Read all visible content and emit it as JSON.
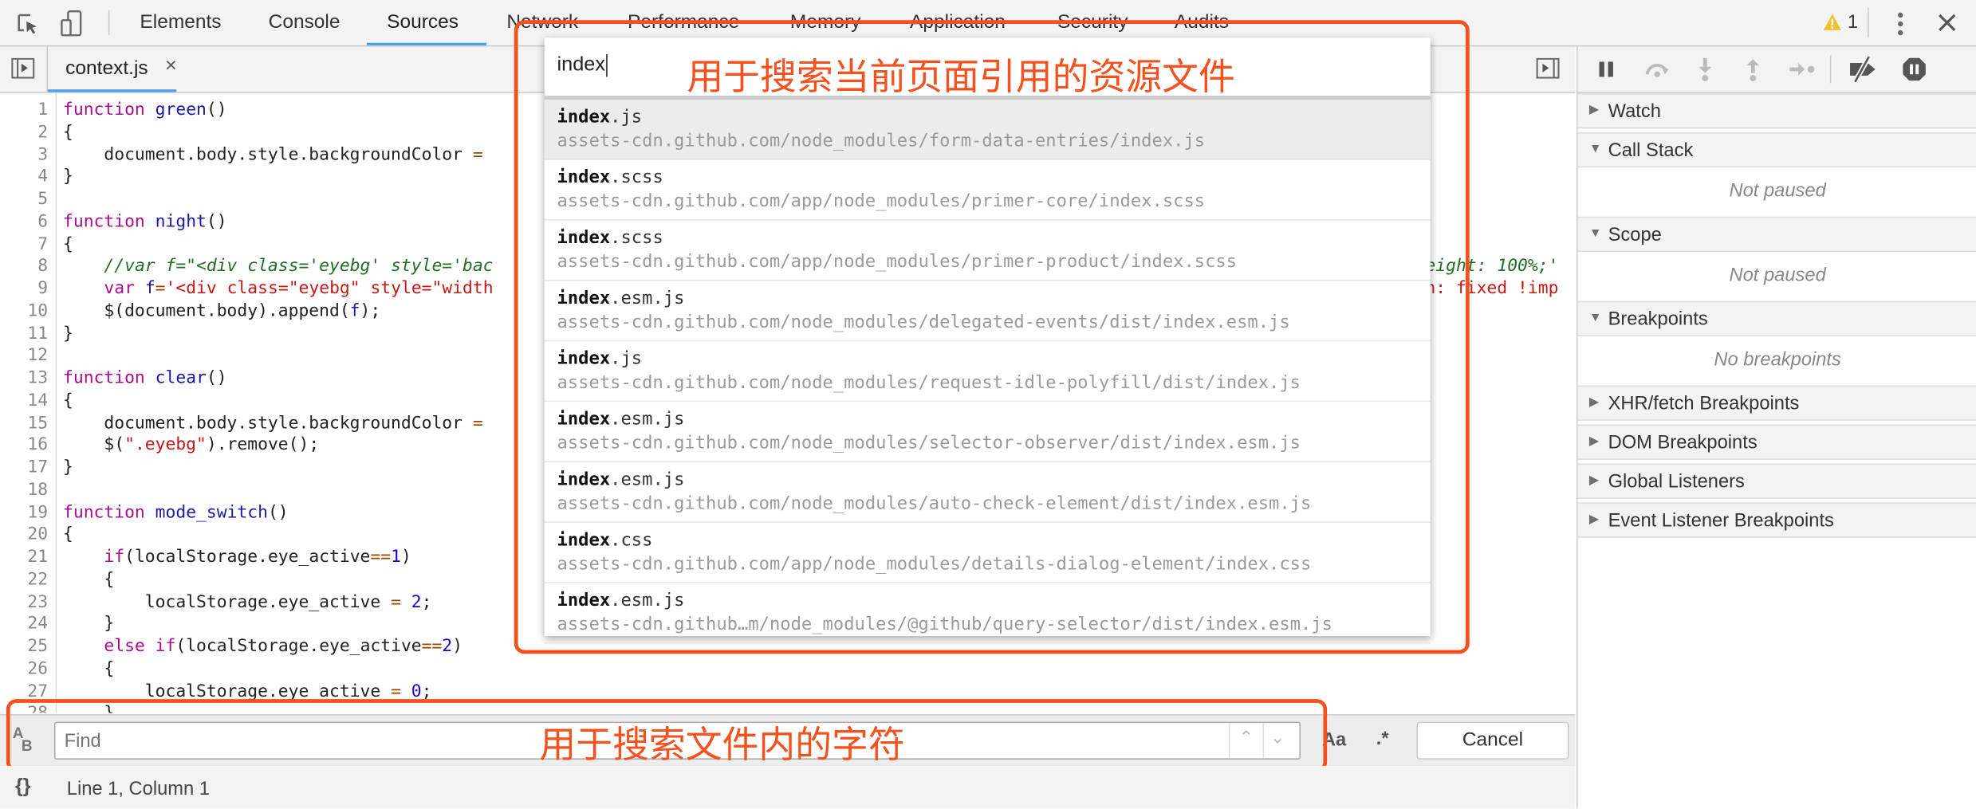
{
  "toolbar": {
    "tabs": [
      {
        "label": "Elements"
      },
      {
        "label": "Console"
      },
      {
        "label": "Sources"
      },
      {
        "label": "Network"
      },
      {
        "label": "Performance"
      },
      {
        "label": "Memory"
      },
      {
        "label": "Application"
      },
      {
        "label": "Security"
      },
      {
        "label": "Audits"
      }
    ],
    "active_tab": "Sources",
    "warning_count": "1",
    "accent_color": "#4a9fe8"
  },
  "editor": {
    "file_tab": "context.js",
    "close_glyph": "×",
    "lines": [
      [
        [
          "kw",
          "function"
        ],
        [
          "pl",
          " "
        ],
        [
          "fn",
          "green"
        ],
        [
          "pl",
          "()"
        ]
      ],
      [
        [
          "pl",
          "{"
        ]
      ],
      [
        [
          "pl",
          "    document.body.style.backgroundColor "
        ],
        [
          "op",
          "="
        ]
      ],
      [
        [
          "pl",
          "}"
        ]
      ],
      [],
      [
        [
          "kw",
          "function"
        ],
        [
          "pl",
          " "
        ],
        [
          "fn",
          "night"
        ],
        [
          "pl",
          "()"
        ]
      ],
      [
        [
          "pl",
          "{"
        ]
      ],
      [
        [
          "pl",
          "    "
        ],
        [
          "cm",
          "//var f=\"<div class='eyebg' style='bac"
        ]
      ],
      [
        [
          "pl",
          "    "
        ],
        [
          "kw",
          "var"
        ],
        [
          "pl",
          " "
        ],
        [
          "fn",
          "f"
        ],
        [
          "op",
          "="
        ],
        [
          "str",
          "'<div class=\"eyebg\" style=\"width"
        ]
      ],
      [
        [
          "pl",
          "    $(document.body).append("
        ],
        [
          "fn",
          "f"
        ],
        [
          "pl",
          ");"
        ]
      ],
      [
        [
          "pl",
          "}"
        ]
      ],
      [],
      [
        [
          "kw",
          "function"
        ],
        [
          "pl",
          " "
        ],
        [
          "fn",
          "clear"
        ],
        [
          "pl",
          "()"
        ]
      ],
      [
        [
          "pl",
          "{"
        ]
      ],
      [
        [
          "pl",
          "    document.body.style.backgroundColor "
        ],
        [
          "op",
          "="
        ]
      ],
      [
        [
          "pl",
          "    $("
        ],
        [
          "str",
          "\".eyebg\""
        ],
        [
          "pl",
          ").remove();"
        ]
      ],
      [
        [
          "pl",
          "}"
        ]
      ],
      [],
      [
        [
          "kw",
          "function"
        ],
        [
          "pl",
          " "
        ],
        [
          "fn",
          "mode_switch"
        ],
        [
          "pl",
          "()"
        ]
      ],
      [
        [
          "pl",
          "{"
        ]
      ],
      [
        [
          "pl",
          "    "
        ],
        [
          "kw",
          "if"
        ],
        [
          "pl",
          "(localStorage.eye_active"
        ],
        [
          "op",
          "=="
        ],
        [
          "num",
          "1"
        ],
        [
          "pl",
          ")"
        ]
      ],
      [
        [
          "pl",
          "    {"
        ]
      ],
      [
        [
          "pl",
          "        localStorage.eye_active "
        ],
        [
          "op",
          "="
        ],
        [
          "pl",
          " "
        ],
        [
          "num",
          "2"
        ],
        [
          "pl",
          ";"
        ]
      ],
      [
        [
          "pl",
          "    }"
        ]
      ],
      [
        [
          "pl",
          "    "
        ],
        [
          "kw",
          "else"
        ],
        [
          "pl",
          " "
        ],
        [
          "kw",
          "if"
        ],
        [
          "pl",
          "(localStorage.eye_active"
        ],
        [
          "op",
          "=="
        ],
        [
          "num",
          "2"
        ],
        [
          "pl",
          ")"
        ]
      ],
      [
        [
          "pl",
          "    {"
        ]
      ],
      [
        [
          "pl",
          "        localStorage.eye_active "
        ],
        [
          "op",
          "="
        ],
        [
          "pl",
          " "
        ],
        [
          "num",
          "0"
        ],
        [
          "pl",
          ";"
        ]
      ],
      [
        [
          "pl",
          "    }"
        ]
      ]
    ],
    "right_fragments": [
      {
        "line": 8,
        "cls": "cm",
        "text": "eight: 100%;'"
      },
      {
        "line": 9,
        "cls": "str",
        "text": "n: fixed !imp"
      }
    ]
  },
  "open_file": {
    "query": "index",
    "annotation": "用于搜索当前页面引用的资源文件",
    "results": [
      {
        "match": "index",
        "rest": ".js",
        "path": "assets-cdn.github.com/node_modules/form-data-entries/index.js"
      },
      {
        "match": "index",
        "rest": ".scss",
        "path": "assets-cdn.github.com/app/node_modules/primer-core/index.scss"
      },
      {
        "match": "index",
        "rest": ".scss",
        "path": "assets-cdn.github.com/app/node_modules/primer-product/index.scss"
      },
      {
        "match": "index",
        "rest": ".esm.js",
        "path": "assets-cdn.github.com/node_modules/delegated-events/dist/index.esm.js"
      },
      {
        "match": "index",
        "rest": ".js",
        "path": "assets-cdn.github.com/node_modules/request-idle-polyfill/dist/index.js"
      },
      {
        "match": "index",
        "rest": ".esm.js",
        "path": "assets-cdn.github.com/node_modules/selector-observer/dist/index.esm.js"
      },
      {
        "match": "index",
        "rest": ".esm.js",
        "path": "assets-cdn.github.com/node_modules/auto-check-element/dist/index.esm.js"
      },
      {
        "match": "index",
        "rest": ".css",
        "path": "assets-cdn.github.com/app/node_modules/details-dialog-element/index.css"
      },
      {
        "match": "index",
        "rest": ".esm.js",
        "path": "assets-cdn.github…m/node_modules/@github/query-selector/dist/index.esm.js"
      }
    ]
  },
  "find": {
    "placeholder": "Find",
    "annotation": "用于搜索文件内的字符",
    "match_case_label": "Aa",
    "regex_label": ".*",
    "cancel_label": "Cancel",
    "replace_icon_label": "AB"
  },
  "status": {
    "format_glyph": "{}",
    "position": "Line 1, Column 1"
  },
  "sidebar": {
    "sections": [
      {
        "label": "Watch",
        "expanded": false
      },
      {
        "label": "Call Stack",
        "expanded": true,
        "empty": "Not paused"
      },
      {
        "label": "Scope",
        "expanded": true,
        "empty": "Not paused"
      },
      {
        "label": "Breakpoints",
        "expanded": true,
        "empty": "No breakpoints"
      },
      {
        "label": "XHR/fetch Breakpoints",
        "expanded": false
      },
      {
        "label": "DOM Breakpoints",
        "expanded": false
      },
      {
        "label": "Global Listeners",
        "expanded": false
      },
      {
        "label": "Event Listener Breakpoints",
        "expanded": false
      }
    ]
  },
  "annotation_color": "#f4511e"
}
